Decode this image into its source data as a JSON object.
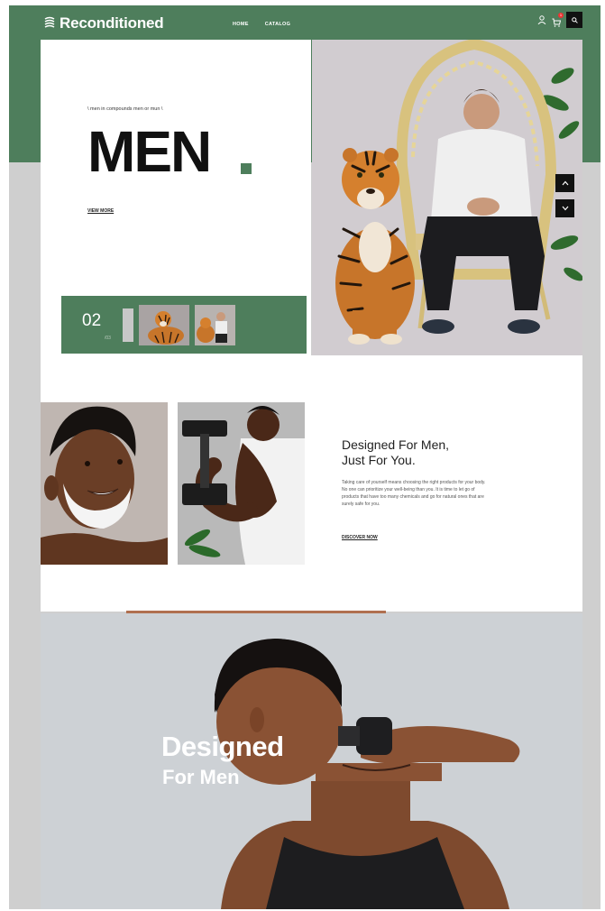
{
  "header": {
    "logo_text": "Reconditioned",
    "nav": [
      "HOME",
      "CATALOG"
    ],
    "cart_count": "1"
  },
  "hero": {
    "tagline": "\\ men in compounds men or mun \\",
    "title": "MEN",
    "link_label": "VIEW MORE",
    "slide_number": "02",
    "slide_total": "/03"
  },
  "feature": {
    "title_line1": "Designed For Men,",
    "title_line2": "Just For You.",
    "body": "Taking care of yourself means choosing the right products for your body. No one can prioritize your well-being than you. It is time to let go of products that have too many chemicals and go for natural ones that are surely safe for you.",
    "link_label": "DISCOVER NOW"
  },
  "banner": {
    "line1": "Designed",
    "line2": "For Men"
  },
  "colors": {
    "brand_green": "#4e7e5c",
    "dark": "#111111"
  }
}
